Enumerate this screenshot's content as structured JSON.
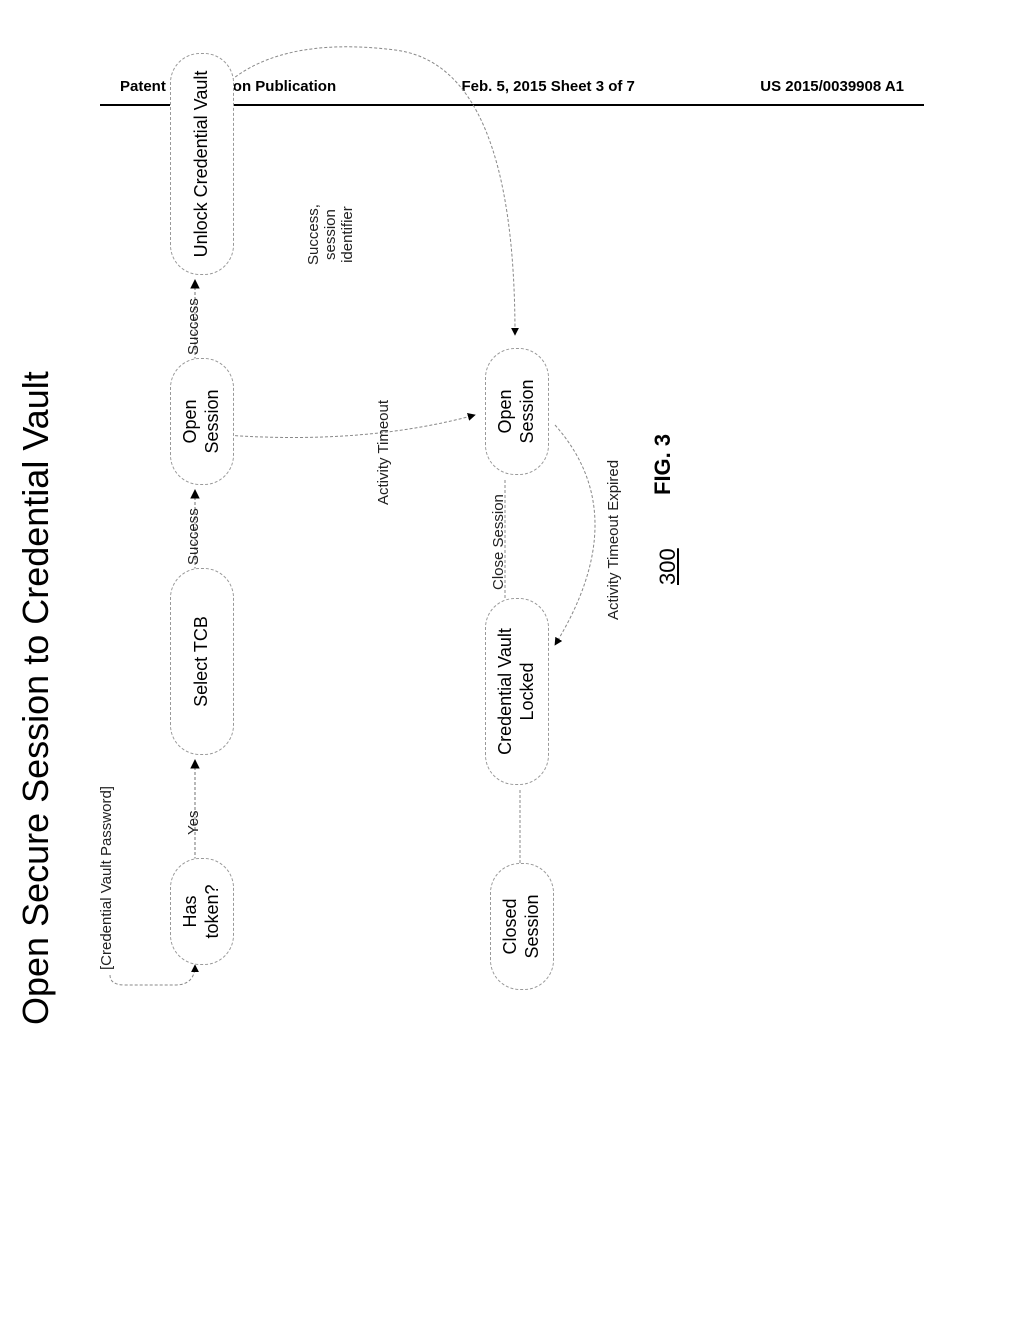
{
  "header": {
    "left": "Patent Application Publication",
    "center": "Feb. 5, 2015   Sheet 3 of 7",
    "right": "US 2015/0039908 A1"
  },
  "diagram": {
    "title": "Open Secure Session to Credential Vault",
    "input_label": "[Credential Vault Password]",
    "nodes": {
      "has_token": "Has token?",
      "select_tcb": "Select TCB",
      "open_session_top": "Open Session",
      "unlock_vault": "Unlock Credential Vault",
      "open_session_bottom": "Open Session",
      "vault_locked": "Credential Vault Locked",
      "closed_session": "Closed Session"
    },
    "edges": {
      "yes": "Yes",
      "success1": "Success",
      "success2": "Success",
      "success_session": "Success, session identifier",
      "activity_timeout": "Activity Timeout",
      "close_session": "Close Session",
      "activity_expired": "Activity Timeout Expired"
    },
    "ref": "300",
    "fig": "FIG. 3"
  }
}
